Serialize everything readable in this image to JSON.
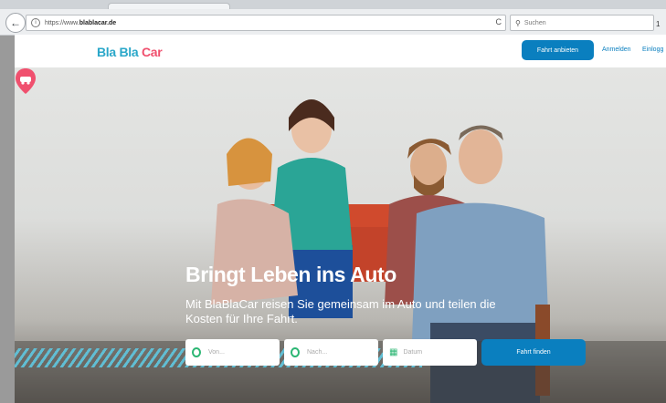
{
  "browser": {
    "url_prefix": "https://www.",
    "url_host": "blablacar.de",
    "search_placeholder": "Suchen",
    "reload_glyph": "C",
    "back_glyph": "←",
    "info_glyph": "i",
    "extra_glyph": "1"
  },
  "header": {
    "logo": {
      "part1": "Bla",
      "part2": "Bla",
      "part3": "Car"
    },
    "offer_button": "Fahrt anbieten",
    "register_link": "Anmelden",
    "login_link": "Einlogg"
  },
  "hero": {
    "title": "Bringt Leben ins Auto",
    "subtitle": "Mit BlaBlaCar reisen Sie gemeinsam im Auto und teilen die Kosten für Ihre Fahrt."
  },
  "search_form": {
    "from_placeholder": "Von...",
    "to_placeholder": "Nach...",
    "date_placeholder": "Datum",
    "submit_label": "Fahrt finden"
  },
  "colors": {
    "brand_blue": "#0a7fbf",
    "logo_teal": "#2aa7c9",
    "logo_pink": "#f0506e",
    "field_icon_green": "#2bb673",
    "stripe_cyan": "#5fc7e0"
  }
}
